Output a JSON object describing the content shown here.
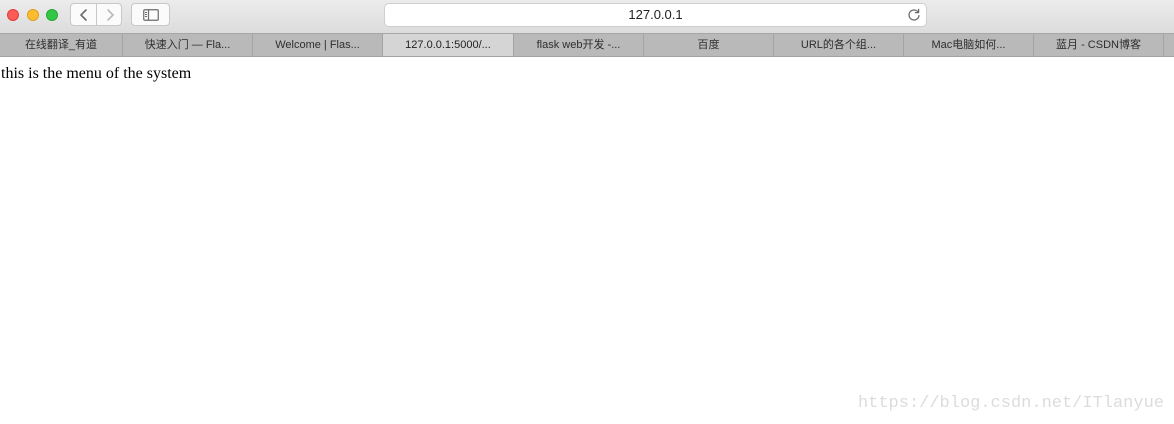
{
  "browser": {
    "address": "127.0.0.1",
    "tabs": [
      {
        "label": "在线翻译_有道",
        "active": false
      },
      {
        "label": "快速入门 — Fla...",
        "active": false
      },
      {
        "label": "Welcome | Flas...",
        "active": false
      },
      {
        "label": "127.0.0.1:5000/...",
        "active": true
      },
      {
        "label": "flask web开发 -...",
        "active": false
      },
      {
        "label": "百度",
        "active": false
      },
      {
        "label": "URL的各个组...",
        "active": false
      },
      {
        "label": "Mac电脑如何...",
        "active": false
      },
      {
        "label": "蓝月 - CSDN博客",
        "active": false
      }
    ]
  },
  "page": {
    "body_text": "this is the menu of the system"
  },
  "watermark": "https://blog.csdn.net/ITlanyue",
  "colors": {
    "close": "#fc5b57",
    "minimize": "#fdbc2e",
    "zoom": "#33c748",
    "active_tab": "#d5d5d5",
    "tab_bar": "#b9b9b9"
  },
  "icons": [
    "back-arrow-icon",
    "forward-arrow-icon",
    "sidebar-icon",
    "reload-icon"
  ]
}
